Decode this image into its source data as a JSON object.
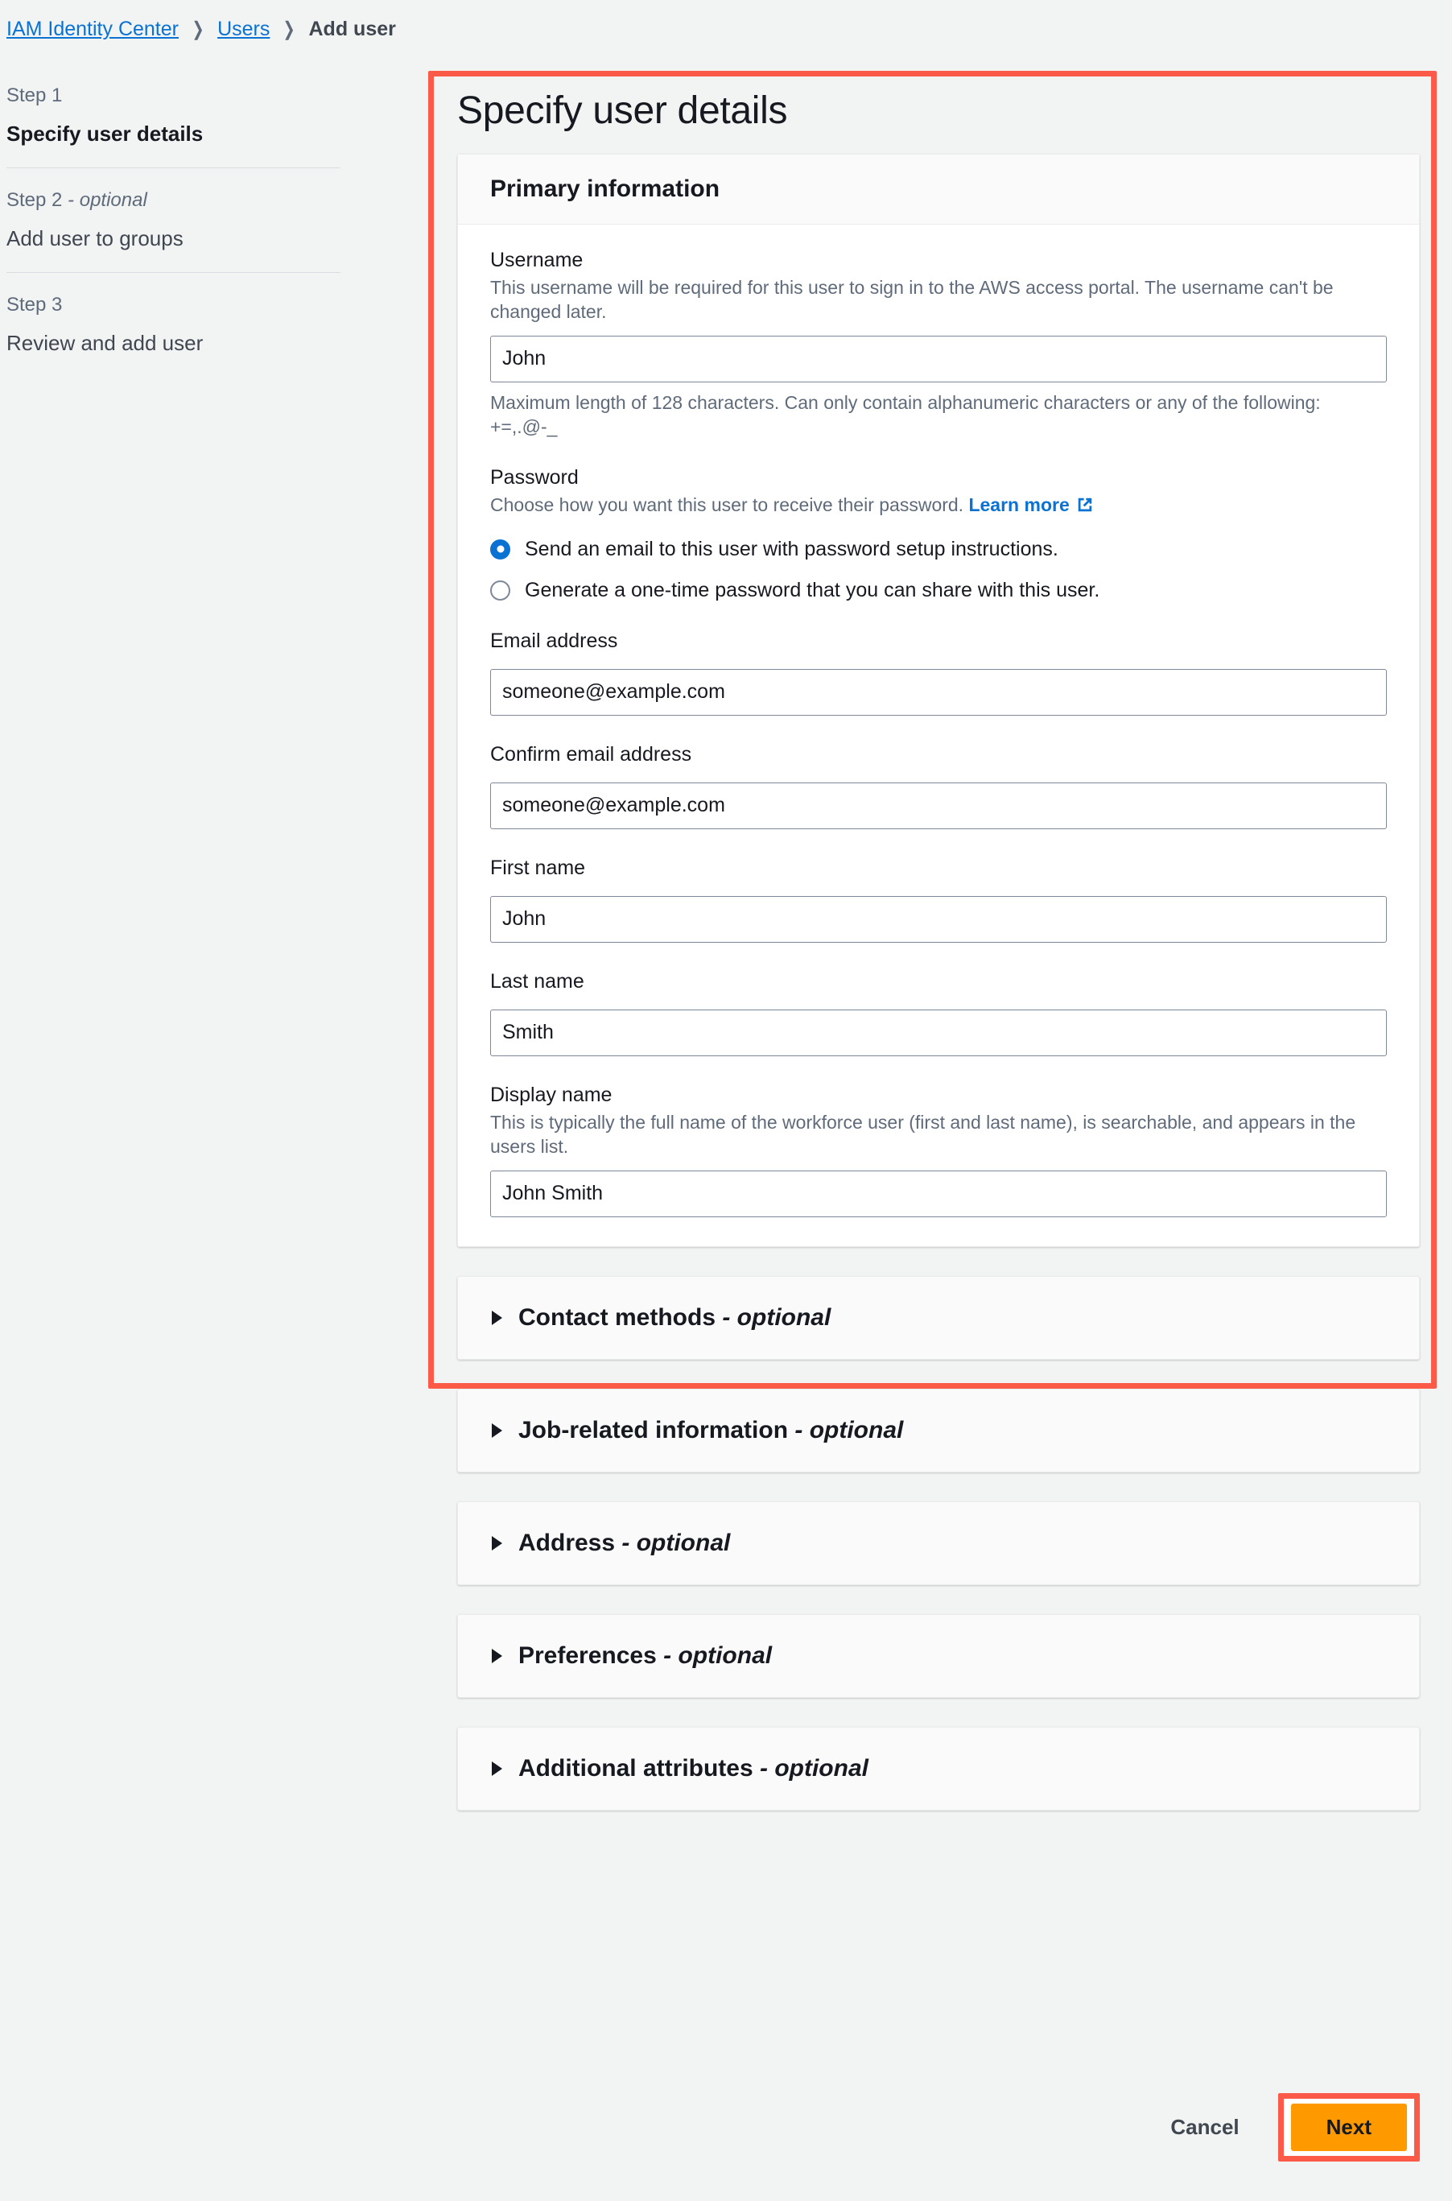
{
  "breadcrumb": {
    "items": [
      {
        "label": "IAM Identity Center",
        "type": "link"
      },
      {
        "label": "Users",
        "type": "link"
      },
      {
        "label": "Add user",
        "type": "current"
      }
    ],
    "separator": "❯"
  },
  "sidebar": {
    "steps": [
      {
        "kicker": "Step 1",
        "optional_suffix": "",
        "title": "Specify user details",
        "active": true
      },
      {
        "kicker": "Step 2",
        "optional_suffix": " - optional",
        "title": "Add user to groups",
        "active": false
      },
      {
        "kicker": "Step 3",
        "optional_suffix": "",
        "title": "Review and add user",
        "active": false
      }
    ]
  },
  "page": {
    "title": "Specify user details"
  },
  "primary_information": {
    "header": "Primary information",
    "username": {
      "label": "Username",
      "description": "This username will be required for this user to sign in to the AWS access portal. The username can't be changed later.",
      "value": "John",
      "hint": "Maximum length of 128 characters. Can only contain alphanumeric characters or any of the following: +=,.@-_"
    },
    "password": {
      "label": "Password",
      "description": "Choose how you want this user to receive their password.",
      "learn_more": "Learn more",
      "options": [
        {
          "label": "Send an email to this user with password setup instructions.",
          "selected": true
        },
        {
          "label": "Generate a one-time password that you can share with this user.",
          "selected": false
        }
      ]
    },
    "email_address": {
      "label": "Email address",
      "value": "someone@example.com"
    },
    "confirm_email_address": {
      "label": "Confirm email address",
      "value": "someone@example.com"
    },
    "first_name": {
      "label": "First name",
      "value": "John"
    },
    "last_name": {
      "label": "Last name",
      "value": "Smith"
    },
    "display_name": {
      "label": "Display name",
      "description": "This is typically the full name of the workforce user (first and last name), is searchable, and appears in the users list.",
      "value": "John Smith"
    }
  },
  "optional_sections": [
    {
      "title": "Contact methods",
      "optional_suffix": " - optional"
    },
    {
      "title": "Job-related information",
      "optional_suffix": " - optional"
    },
    {
      "title": "Address",
      "optional_suffix": " - optional"
    },
    {
      "title": "Preferences",
      "optional_suffix": " - optional"
    },
    {
      "title": "Additional attributes",
      "optional_suffix": " - optional"
    }
  ],
  "footer": {
    "cancel_label": "Cancel",
    "next_label": "Next"
  },
  "colors": {
    "link": "#0972d3",
    "highlight_red": "#fb5a49",
    "primary_button": "#ff9900",
    "page_background": "#f2f3f3"
  }
}
